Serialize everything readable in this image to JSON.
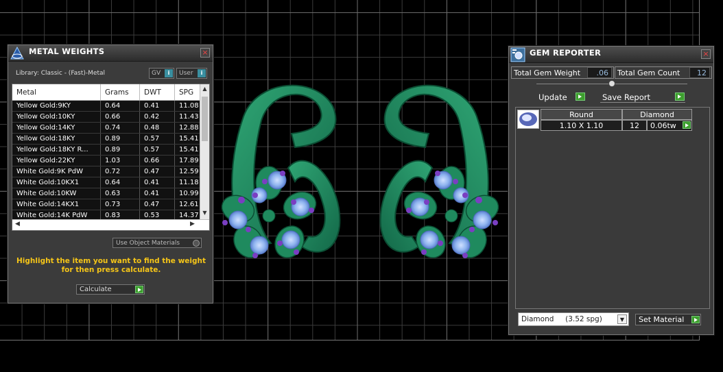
{
  "metal_weights": {
    "title": "METAL WEIGHTS",
    "library": "Library: Classic - (Fast)-Metal",
    "gv_label": "GV",
    "user_label": "User",
    "info_glyph": "i",
    "columns": [
      "Metal",
      "Grams",
      "DWT",
      "SPG"
    ],
    "rows": [
      [
        "Yellow Gold:9KY",
        "0.64",
        "0.41",
        "11.08"
      ],
      [
        "Yellow Gold:10KY",
        "0.66",
        "0.42",
        "11.43"
      ],
      [
        "Yellow Gold:14KY",
        "0.74",
        "0.48",
        "12.88"
      ],
      [
        "Yellow Gold:18KY",
        "0.89",
        "0.57",
        "15.41"
      ],
      [
        "Yellow Gold:18KY R...",
        "0.89",
        "0.57",
        "15.41"
      ],
      [
        "Yellow Gold:22KY",
        "1.03",
        "0.66",
        "17.89"
      ],
      [
        "White Gold:9K PdW",
        "0.72",
        "0.47",
        "12.59"
      ],
      [
        "White Gold:10KX1",
        "0.64",
        "0.41",
        "11.18"
      ],
      [
        "White Gold:10KW",
        "0.63",
        "0.41",
        "10.99"
      ],
      [
        "White Gold:14KX1",
        "0.73",
        "0.47",
        "12.61"
      ],
      [
        "White Gold:14K PdW",
        "0.83",
        "0.53",
        "14.37"
      ]
    ],
    "use_object_materials": "Use Object Materials",
    "hint": "Highlight the item you want to find the weight for then press calculate.",
    "calculate": "Calculate"
  },
  "gem_reporter": {
    "title": "GEM REPORTER",
    "total_gem_weight_label": "Total Gem Weight",
    "total_gem_weight": ".06",
    "total_gem_count_label": "Total Gem Count",
    "total_gem_count": "12",
    "update": "Update",
    "save_report": "Save Report",
    "gem": {
      "shape": "Round",
      "material": "Diamond",
      "size": "1.10 X 1.10",
      "count": "12",
      "weight": "0.06tw"
    },
    "material_select": "Diamond     (3.52 spg)",
    "set_material": "Set Material"
  },
  "colors": {
    "metal": "#1f8a5e",
    "gem_stone": "#8fb4ef",
    "accent_gem": "#7a3ec2",
    "hint_text": "#f5c518"
  }
}
